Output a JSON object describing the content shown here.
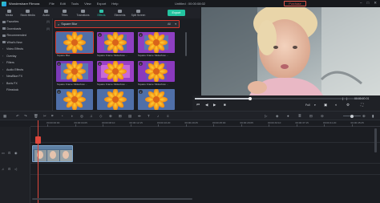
{
  "app": {
    "name": "Wondershare Filmora",
    "menu": [
      "File",
      "Edit",
      "Tools",
      "View",
      "Export",
      "Help"
    ],
    "doc_title": "Untitled : 00:00:08:02",
    "purchase_label": "Purchase"
  },
  "toolbar": {
    "items": [
      {
        "label": "Media",
        "icon": "media-icon"
      },
      {
        "label": "Stock Media",
        "icon": "stock-media-icon"
      },
      {
        "label": "Audio",
        "icon": "audio-icon"
      },
      {
        "label": "Titles",
        "icon": "titles-icon"
      },
      {
        "label": "Transitions",
        "icon": "transitions-icon"
      },
      {
        "label": "Effects",
        "icon": "effects-icon",
        "active": true
      },
      {
        "label": "Elements",
        "icon": "elements-icon"
      },
      {
        "label": "Split Screen",
        "icon": "split-screen-icon"
      }
    ],
    "export_label": "Export"
  },
  "sidebar": {
    "items": [
      {
        "label": "Favorites",
        "count": "(0)"
      },
      {
        "label": "Downloads",
        "count": "(0)"
      },
      {
        "label": "Recommended",
        "count": ""
      },
      {
        "label": "What's New",
        "count": ""
      },
      {
        "label": "Video Effects",
        "count": ""
      },
      {
        "label": "Overlay",
        "count": ""
      },
      {
        "label": "Filters",
        "count": ""
      },
      {
        "label": "Audio Effects",
        "count": ""
      },
      {
        "label": "NewBlue FX",
        "count": ""
      },
      {
        "label": "Boris FX",
        "count": ""
      },
      {
        "label": "Filmstock",
        "count": ""
      }
    ]
  },
  "search": {
    "value": "Square Blur",
    "filter": "All"
  },
  "effects": [
    {
      "label": "Square Blur",
      "style": "blur",
      "selected": true
    },
    {
      "label": "Square Frame Slideshow ...",
      "style": "frame"
    },
    {
      "label": "Square Frame Slideshow ...",
      "style": "frame"
    },
    {
      "label": "Square Frame Slideshow ...",
      "style": "frame"
    },
    {
      "label": "Square Frame Slideshow ...",
      "style": "frame"
    },
    {
      "label": "Square Frame Slideshow ...",
      "style": "frame"
    },
    {
      "label": "",
      "style": "blur"
    },
    {
      "label": "",
      "style": "blur"
    },
    {
      "label": "",
      "style": "blur"
    }
  ],
  "player": {
    "progress": 0.33,
    "timecode": "00:00:00:01",
    "quality": "Full"
  },
  "timeline": {
    "ruler": [
      "00:00:00:00",
      "00:00:04:05",
      "00:00:08:10",
      "00:00:12:15",
      "00:00:16:20",
      "00:00:20:25",
      "00:00:25:00",
      "00:00:29:05",
      "00:00:33:10",
      "00:00:37:15",
      "00:00:41:20",
      "00:00:45:25"
    ]
  }
}
